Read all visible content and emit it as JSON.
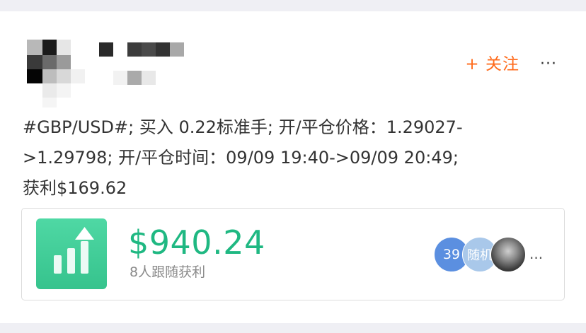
{
  "post": {
    "follow_label": "+ 关注",
    "more_label": "···",
    "content_lines": [
      "#GBP/USD#; 买入 0.22标准手; 开/平仓价格：1.29027-",
      ">1.29798; 开/平仓时间：09/09 19:40->09/09 20:49;",
      "获利$169.62"
    ]
  },
  "profit": {
    "amount": "$940.24",
    "followers_text": "8人跟随获利",
    "avatar_count": "39",
    "avatar_random": "随机",
    "more_avatars": "...",
    "icon": "bar-chart-up-arrow-icon"
  },
  "colors": {
    "accent_orange": "#ff6a1a",
    "profit_green": "#1fb882",
    "icon_green": "#3ecb94"
  }
}
